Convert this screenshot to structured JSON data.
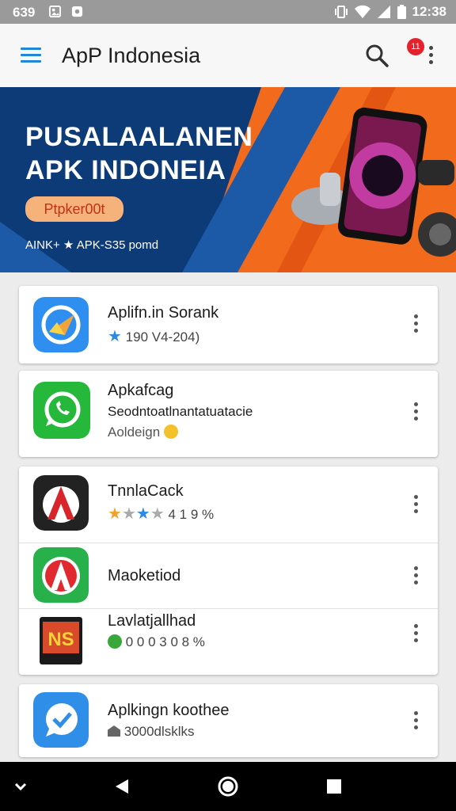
{
  "status_bar": {
    "time_left": "639",
    "time_right": "12:38"
  },
  "app_bar": {
    "title": "ApP Indonesia",
    "notification_count": "11"
  },
  "banner": {
    "headline_line1": "PUSALAALANEN",
    "headline_line2": "APK INDONEIA",
    "button_label": "Ptpker00t",
    "subtext": "AINK+ ★ APK-S35 pomd"
  },
  "cards": [
    {
      "apps": [
        {
          "name": "Aplifn.in Sorank",
          "meta": "190 V4-204)",
          "icon": "compass-app-icon",
          "color": "#2e8ff0"
        }
      ]
    },
    {
      "apps": [
        {
          "name": "Apkafcag",
          "desc": "Seodntoatlnantatuatacie",
          "meta": "Aoldeign",
          "icon": "whatsapp-icon",
          "color": "#25b83a"
        }
      ]
    },
    {
      "apps": [
        {
          "name": "TnnlaCack",
          "meta": "4 1 9 %",
          "rating_text": "4 1 9 %",
          "icon": "red-a-app-icon",
          "color": "#222222"
        },
        {
          "name": "Maoketiod",
          "icon": "red-a-app-icon",
          "color": "#28b04a"
        },
        {
          "name": "Lavlatjallhad",
          "meta": "0 0 0 3 0 8 %",
          "icon": "ns-game-icon",
          "color": "#1a1a1a"
        }
      ]
    },
    {
      "apps": [
        {
          "name": "Aplkingn koothee",
          "meta": "3000dlsklks",
          "icon": "blue-check-app-icon",
          "color": "#2f8fe8"
        }
      ]
    }
  ],
  "colors": {
    "accent": "#1f86d8",
    "banner_blue": "#0d3b78",
    "banner_orange": "#f26a1b",
    "badge": "#e4222c"
  }
}
